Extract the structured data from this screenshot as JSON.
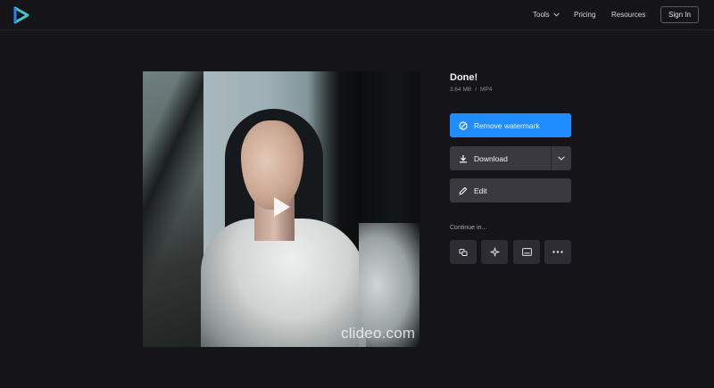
{
  "header": {
    "nav": {
      "tools": "Tools",
      "pricing": "Pricing",
      "resources": "Resources"
    },
    "sign_in": "Sign In"
  },
  "preview": {
    "watermark": "clideo.com"
  },
  "result": {
    "title": "Done!",
    "size": "3.64 MB",
    "separator": "/",
    "format": "MP4"
  },
  "actions": {
    "remove_watermark": "Remove watermark",
    "download": "Download",
    "edit": "Edit"
  },
  "continue_label": "Continue in...",
  "colors": {
    "background": "#151419",
    "accent": "#1f8cff",
    "button": "#3a3940",
    "tool_button": "#2d2c33"
  },
  "icons": {
    "logo": "clideo-logo-icon",
    "remove_watermark": "no-symbol-icon",
    "download": "download-icon",
    "download_options": "chevron-down-icon",
    "edit": "pencil-icon",
    "continue_tools": [
      "merge-icon",
      "sparkle-icon",
      "subtitles-icon",
      "more-icon"
    ]
  }
}
